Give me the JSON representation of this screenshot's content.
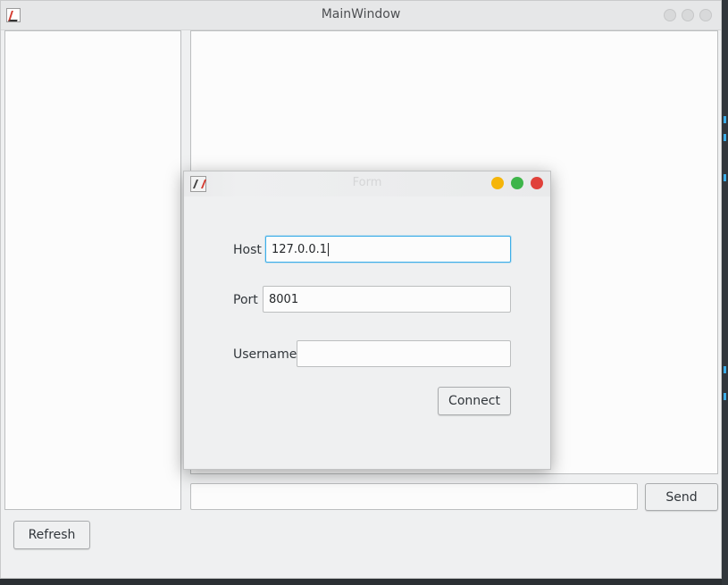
{
  "main_window": {
    "title": "MainWindow",
    "send_label": "Send",
    "refresh_label": "Refresh",
    "message_input_value": ""
  },
  "form_dialog": {
    "title": "Form",
    "host_label": "Host",
    "host_value": "127.0.0.1",
    "port_label": "Port",
    "port_value": "8001",
    "username_label": "Username",
    "username_value": "",
    "connect_label": "Connect"
  },
  "colors": {
    "minimize": "#f5b50a",
    "maximize": "#3eb54a",
    "close": "#e0413a",
    "focus_accent": "#3daee9"
  }
}
